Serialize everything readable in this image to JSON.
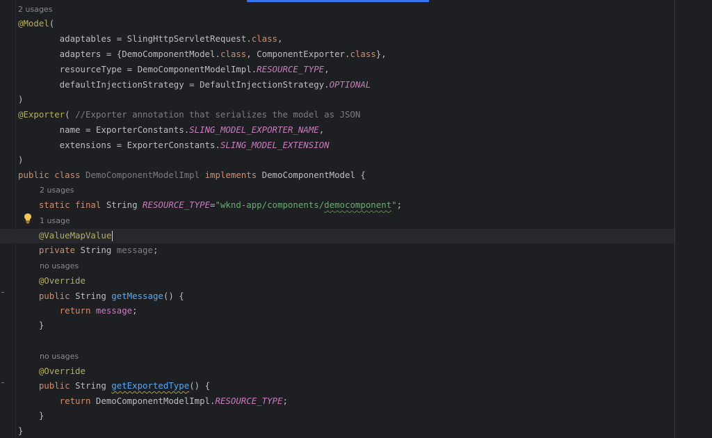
{
  "editor": {
    "hints": {
      "h1": "2 usages",
      "h2": "2 usages",
      "h3": "1 usage",
      "h4": "no usages",
      "h5": "no usages"
    },
    "code": {
      "l1_anno": "@Model",
      "l1_rest": "(",
      "l2_a": "        adaptables = SlingHttpServletRequest.",
      "l2_kw": "class",
      "l2_b": ",",
      "l3_a": "        adapters = {DemoComponentModel.",
      "l3_kw1": "class",
      "l3_b": ", ComponentExporter.",
      "l3_kw2": "class",
      "l3_c": "},",
      "l4_a": "        resourceType = DemoComponentModelImpl.",
      "l4_const": "RESOURCE_TYPE",
      "l4_b": ",",
      "l5_a": "        defaultInjectionStrategy = DefaultInjectionStrategy.",
      "l5_const": "OPTIONAL",
      "l6": ")",
      "l7_anno": "@Exporter",
      "l7_b": "( ",
      "l7_cmt": "//Exporter annotation that serializes the model as JSON",
      "l8_a": "        name = ExporterConstants.",
      "l8_const": "SLING_MODEL_EXPORTER_NAME",
      "l8_b": ",",
      "l9_a": "        extensions = ExporterConstants.",
      "l9_const": "SLING_MODEL_EXTENSION",
      "l10": ")",
      "l11_kw": "public class ",
      "l11_name": "DemoComponentModelImpl",
      "l11_kw2": " implements ",
      "l11_b": "DemoComponentModel {",
      "l12_kw": "    static final ",
      "l12_a": "String ",
      "l12_const": "RESOURCE_TYPE",
      "l12_b": "=",
      "l12_str1": "\"wknd-app/components/",
      "l12_str2": "democomponent",
      "l12_str3": "\"",
      "l12_c": ";",
      "l13_anno": "    @ValueMapValue",
      "l14_kw": "    private ",
      "l14_a": "String ",
      "l14_field": "message",
      "l14_b": ";",
      "l15_anno": "    @Override",
      "l16_kw": "    public ",
      "l16_a": "String ",
      "l16_fn": "getMessage",
      "l16_b": "() {",
      "l17_kw": "        return ",
      "l17_field": "message",
      "l17_b": ";",
      "l18": "    }",
      "l19_anno": "    @Override",
      "l20_kw": "    public ",
      "l20_a": "String ",
      "l20_fn": "getExportedType",
      "l20_b": "() {",
      "l21_kw": "        return ",
      "l21_a": "DemoComponentModelImpl.",
      "l21_const": "RESOURCE_TYPE",
      "l21_b": ";",
      "l22": "    }",
      "l23": "}"
    },
    "colors": {
      "background": "#1e1f22",
      "keyword": "#cf8e6d",
      "annotation": "#b3ae60",
      "string": "#6aab73",
      "constant": "#c77dbb",
      "function": "#56a8f5",
      "comment": "#7a7e85",
      "accent": "#3574f0"
    },
    "icons": {
      "intention": "lightbulb-icon"
    }
  }
}
